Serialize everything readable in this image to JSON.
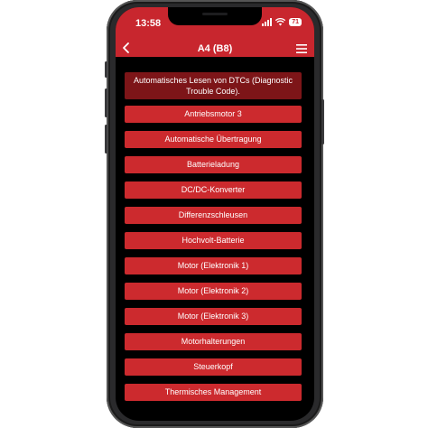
{
  "status_bar": {
    "time": "13:58",
    "battery": "71"
  },
  "nav": {
    "title": "A4 (B8)",
    "back_icon": "chevron-left-icon",
    "menu_icon": "hamburger-menu-icon"
  },
  "header": {
    "text": "Automatisches Lesen von DTCs (Diagnostic Trouble Code)."
  },
  "items": [
    {
      "label": "Antriebsmotor 3"
    },
    {
      "label": "Automatische Übertragung"
    },
    {
      "label": "Batterieladung"
    },
    {
      "label": "DC/DC-Konverter"
    },
    {
      "label": "Differenzschleusen"
    },
    {
      "label": "Hochvolt-Batterie"
    },
    {
      "label": "Motor (Elektronik 1)"
    },
    {
      "label": "Motor (Elektronik 2)"
    },
    {
      "label": "Motor (Elektronik 3)"
    },
    {
      "label": "Motorhalterungen"
    },
    {
      "label": "Steuerkopf"
    },
    {
      "label": "Thermisches Management"
    }
  ],
  "colors": {
    "accent": "#c8262e",
    "header_box": "#7d1518",
    "background": "#000000"
  }
}
